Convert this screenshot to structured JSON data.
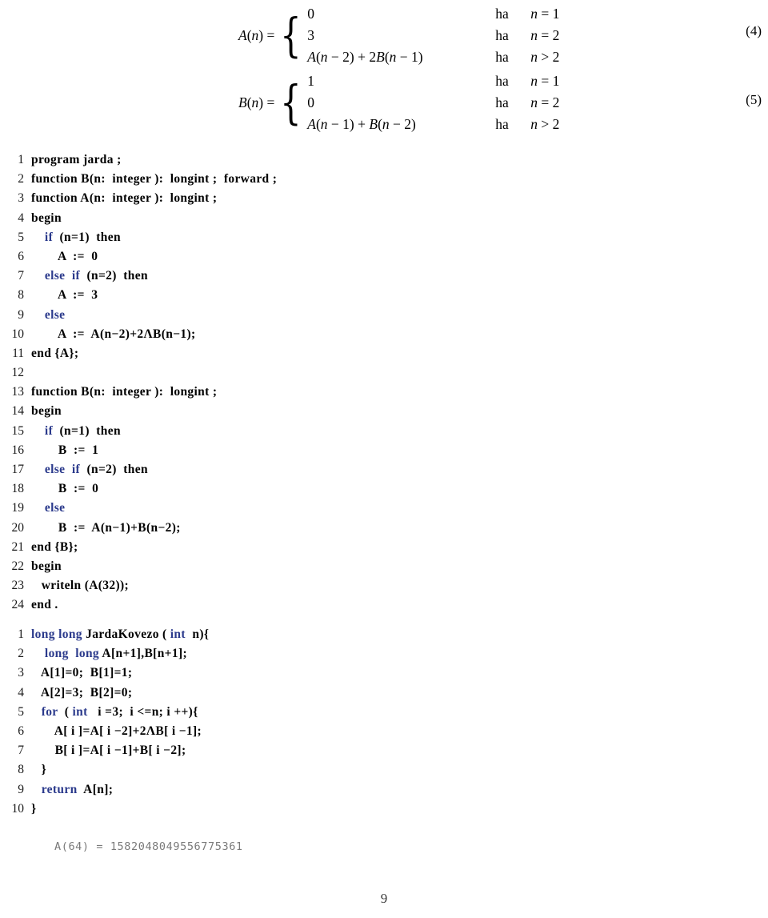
{
  "equations": [
    {
      "tag": "(4)",
      "lhs_fn": "A",
      "lhs": "A(n) =",
      "rows": [
        {
          "value": "0",
          "ha": "ha",
          "cond": "n = 1"
        },
        {
          "value": "3",
          "ha": "ha",
          "cond": "n = 2"
        },
        {
          "value": "A(n − 2) + 2B(n − 1)",
          "ha": "ha",
          "cond": "n > 2"
        }
      ]
    },
    {
      "tag": "(5)",
      "lhs_fn": "B",
      "lhs": "B(n) =",
      "rows": [
        {
          "value": "1",
          "ha": "ha",
          "cond": "n = 1"
        },
        {
          "value": "0",
          "ha": "ha",
          "cond": "n = 2"
        },
        {
          "value": "A(n − 1) + B(n − 2)",
          "ha": "ha",
          "cond": "n > 2"
        }
      ]
    }
  ],
  "pascal_listing": {
    "language": "pascal",
    "lines": [
      {
        "n": "1",
        "text": "program jarda ;"
      },
      {
        "n": "2",
        "text": "function B(n:  integer ):  longint ;  forward ;"
      },
      {
        "n": "3",
        "text": "function A(n:  integer ):  longint ;"
      },
      {
        "n": "4",
        "text": "begin"
      },
      {
        "n": "5",
        "text": "    if  (n=1)  then"
      },
      {
        "n": "6",
        "text": "        A  :=  0"
      },
      {
        "n": "7",
        "text": "    else  if  (n=2)  then"
      },
      {
        "n": "8",
        "text": "        A  :=  3"
      },
      {
        "n": "9",
        "text": "    else"
      },
      {
        "n": "10",
        "text": "        A  :=  A(n−2)+2ΛB(n−1);"
      },
      {
        "n": "11",
        "text": "end {A};"
      },
      {
        "n": "12",
        "text": ""
      },
      {
        "n": "13",
        "text": "function B(n:  integer ):  longint ;"
      },
      {
        "n": "14",
        "text": "begin"
      },
      {
        "n": "15",
        "text": "    if  (n=1)  then"
      },
      {
        "n": "16",
        "text": "        B  :=  1"
      },
      {
        "n": "17",
        "text": "    else  if  (n=2)  then"
      },
      {
        "n": "18",
        "text": "        B  :=  0"
      },
      {
        "n": "19",
        "text": "    else"
      },
      {
        "n": "20",
        "text": "        B  :=  A(n−1)+B(n−2);"
      },
      {
        "n": "21",
        "text": "end {B};"
      },
      {
        "n": "22",
        "text": "begin"
      },
      {
        "n": "23",
        "text": "   writeln (A(32));"
      },
      {
        "n": "24",
        "text": "end ."
      }
    ],
    "keywords": [
      "if",
      "else"
    ]
  },
  "c_listing": {
    "language": "c",
    "lines": [
      {
        "n": "1",
        "text": "long long JardaKovezo ( int  n){"
      },
      {
        "n": "2",
        "text": "    long  long A[n+1],B[n+1];"
      },
      {
        "n": "3",
        "text": "   A[1]=0;  B[1]=1;"
      },
      {
        "n": "4",
        "text": "   A[2]=3;  B[2]=0;"
      },
      {
        "n": "5",
        "text": "   for  ( int   i =3;  i <=n; i ++){"
      },
      {
        "n": "6",
        "text": "       A[ i ]=A[ i −2]+2ΛB[ i −1];"
      },
      {
        "n": "7",
        "text": "       B[ i ]=A[ i −1]+B[ i −2];"
      },
      {
        "n": "8",
        "text": "   }"
      },
      {
        "n": "9",
        "text": "   return  A[n];"
      },
      {
        "n": "10",
        "text": "}"
      }
    ],
    "keywords": [
      "long",
      "int",
      "for",
      "return"
    ]
  },
  "program_output": "A(64) = 1582048049556775361",
  "page_number": "9",
  "colors": {
    "keyword_blue": "#2b3a8c",
    "code_black": "#000000",
    "output_gray": "#7a7a7a",
    "lineno_gray": "#1a1a1a"
  }
}
